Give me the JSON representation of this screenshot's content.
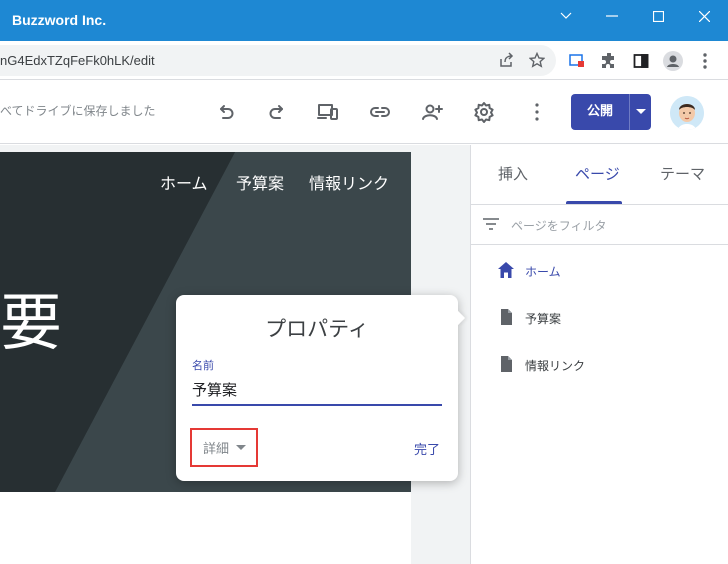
{
  "window": {
    "title": "Buzzword Inc."
  },
  "browser": {
    "url": "nG4EdxTZqFeFk0hLK/edit"
  },
  "toolbar": {
    "save_status": "べてドライブに保存しました",
    "publish_label": "公開"
  },
  "hero": {
    "nav": [
      "ホーム",
      "予算案",
      "情報リンク"
    ],
    "big_text": "要"
  },
  "properties_popup": {
    "title": "プロパティ",
    "name_label": "名前",
    "name_value": "予算案",
    "details_label": "詳細",
    "done_label": "完了"
  },
  "side_panel": {
    "tabs": [
      {
        "label": "挿入"
      },
      {
        "label": "ページ"
      },
      {
        "label": "テーマ"
      }
    ],
    "active_tab": "ページ",
    "filter_placeholder": "ページをフィルタ",
    "pages": [
      {
        "label": "ホーム",
        "icon": "home-icon"
      },
      {
        "label": "予算案",
        "icon": "page-icon"
      },
      {
        "label": "情報リンク",
        "icon": "page-icon"
      }
    ]
  },
  "colors": {
    "titlebar": "#1e88d3",
    "accent": "#3949ab",
    "highlight_box": "#e53935"
  }
}
